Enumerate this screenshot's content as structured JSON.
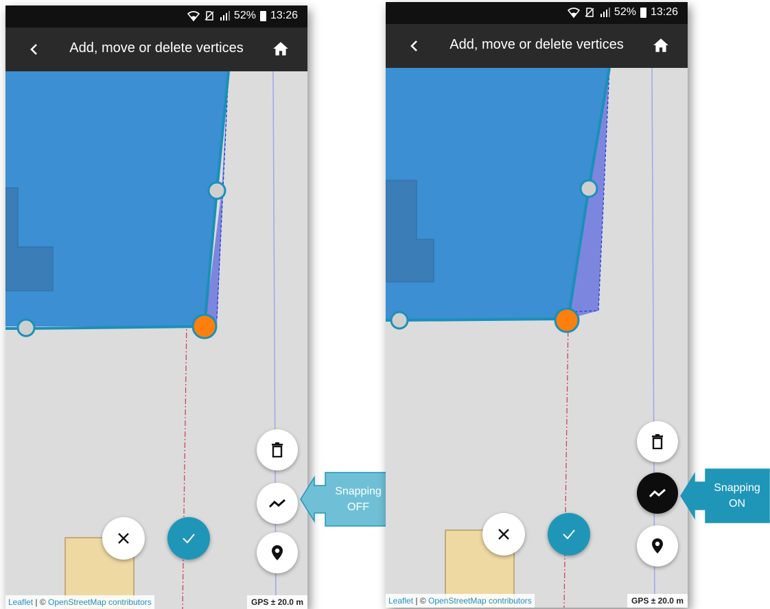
{
  "statusbar": {
    "battery": "52%",
    "time": "13:26"
  },
  "appbar": {
    "title": "Add, move or delete vertices"
  },
  "footer": {
    "attribution_leaflet": "Leaflet",
    "attribution_separator": " | © ",
    "attribution_osm": "OpenStreetMap contributors",
    "gps": "GPS ± 20.0 m"
  },
  "left_panel": {
    "snapping_state": "off"
  },
  "right_panel": {
    "snapping_state": "on"
  },
  "callout_left": {
    "line1": "Snapping",
    "line2": "OFF"
  },
  "callout_right": {
    "line1": "Snapping",
    "line2": "ON"
  },
  "colors": {
    "parcel_fill": "#3b8fd2",
    "parcel_edge": "#1a90b8",
    "snap_area": "#7d86de",
    "active_vertex": "#ff7f0e",
    "vertex": "#cfcfcf",
    "building": "#eed9a3",
    "callout": "#1f96b8"
  }
}
